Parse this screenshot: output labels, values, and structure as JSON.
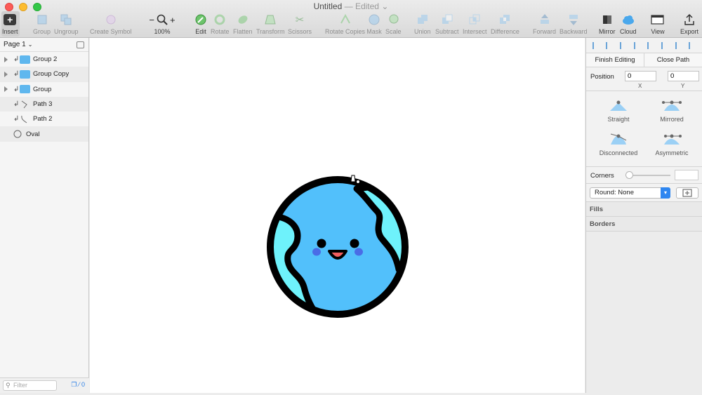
{
  "window": {
    "title": "Untitled",
    "status": "— Edited"
  },
  "toolbar": {
    "insert": "Insert",
    "group": "Group",
    "ungroup": "Ungroup",
    "create_symbol": "Create Symbol",
    "zoom": "100%",
    "edit": "Edit",
    "rotate": "Rotate",
    "flatten": "Flatten",
    "transform": "Transform",
    "scissors": "Scissors",
    "rotate_copies": "Rotate Copies",
    "mask": "Mask",
    "scale": "Scale",
    "union": "Union",
    "subtract": "Subtract",
    "intersect": "Intersect",
    "difference": "Difference",
    "forward": "Forward",
    "backward": "Backward",
    "mirror": "Mirror",
    "cloud": "Cloud",
    "view": "View",
    "export": "Export"
  },
  "layers": {
    "page": "Page 1",
    "items": [
      {
        "name": "Group 2",
        "type": "group"
      },
      {
        "name": "Group Copy",
        "type": "group"
      },
      {
        "name": "Group",
        "type": "group"
      },
      {
        "name": "Path 3",
        "type": "path"
      },
      {
        "name": "Path 2",
        "type": "path"
      },
      {
        "name": "Oval",
        "type": "oval"
      }
    ],
    "filter_placeholder": "Filter",
    "badge_count": "0"
  },
  "inspector": {
    "finish_editing": "Finish Editing",
    "close_path": "Close Path",
    "position_label": "Position",
    "x_value": "0",
    "y_value": "0",
    "x_label": "X",
    "y_label": "Y",
    "point_types": [
      "Straight",
      "Mirrored",
      "Disconnected",
      "Asymmetric"
    ],
    "corners_label": "Corners",
    "round_value": "Round: None",
    "fills": "Fills",
    "borders": "Borders"
  },
  "colors": {
    "earth_ocean": "#52c0fb",
    "earth_land": "#6ef2fb",
    "blush": "#4a6ce6",
    "mouth": "#f15e5e",
    "outline": "#000000",
    "accent": "#2e86f0"
  }
}
